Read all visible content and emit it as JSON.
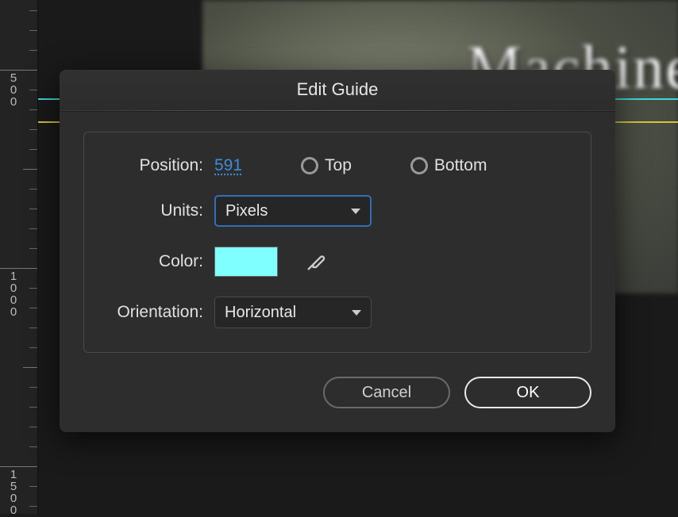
{
  "dialog": {
    "title": "Edit Guide",
    "labels": {
      "position": "Position:",
      "units": "Units:",
      "color": "Color:",
      "orientation": "Orientation:"
    },
    "position_value": "591",
    "radio_top": "Top",
    "radio_bottom": "Bottom",
    "units_value": "Pixels",
    "color_value": "#7fffff",
    "orientation_value": "Horizontal",
    "buttons": {
      "cancel": "Cancel",
      "ok": "OK"
    }
  },
  "ruler": {
    "marks": [
      "500",
      "1000",
      "1500"
    ]
  },
  "canvas": {
    "overlay_text": "Machine"
  }
}
